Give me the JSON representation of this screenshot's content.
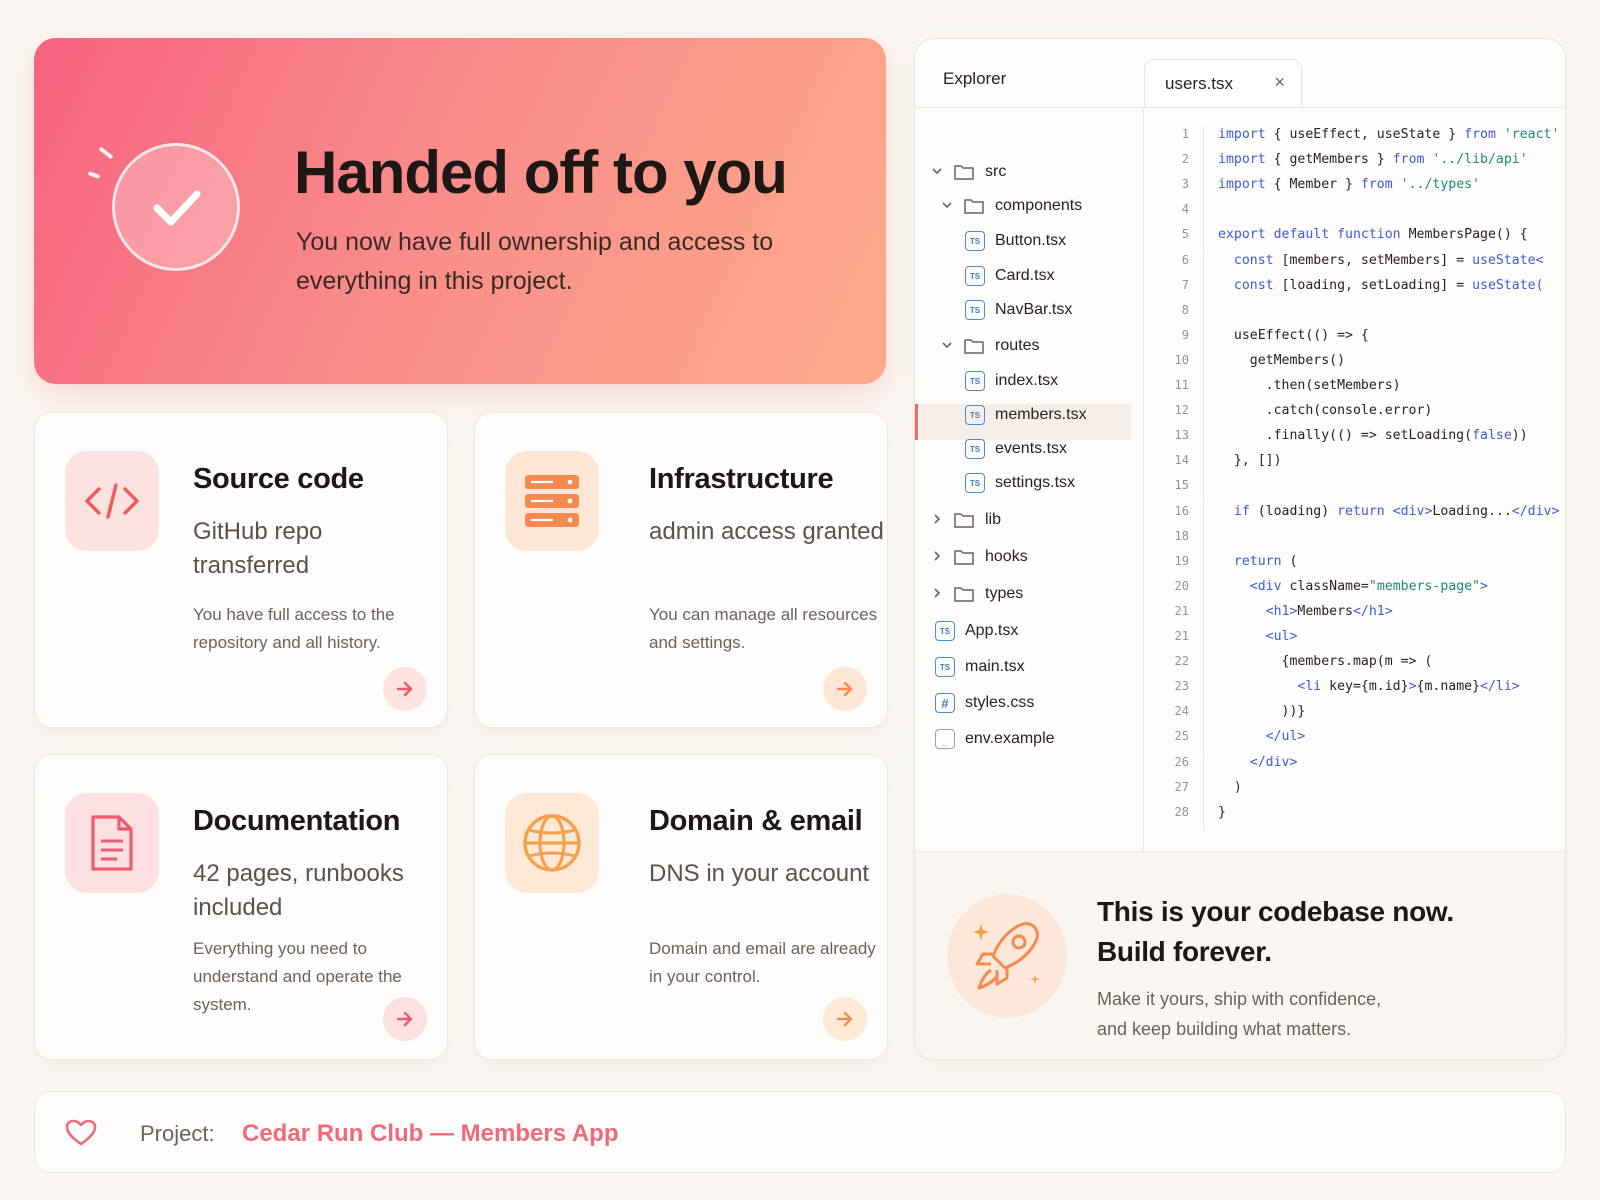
{
  "hero": {
    "title": "Handed off to you",
    "subtitle": "You now have full ownership and access to everything in this project.",
    "icon": "check-circle-icon"
  },
  "cards": [
    {
      "icon": "code-icon",
      "title": "Source code",
      "subtitle": "GitHub repo transferred",
      "description": "You have full access to the repository and all history.",
      "accent": "#f06a6a"
    },
    {
      "icon": "server-icon",
      "title": "Infrastructure",
      "subtitle": "admin access granted",
      "description": "You can manage all resources and settings.",
      "accent": "#f5894e"
    },
    {
      "icon": "document-icon",
      "title": "Documentation",
      "subtitle": "42 pages, runbooks included",
      "description": "Everything you need to understand and operate the system.",
      "accent": "#ef5a72"
    },
    {
      "icon": "globe-icon",
      "title": "Domain & email",
      "subtitle": "DNS in your account",
      "description": "Domain and email are already in your control.",
      "accent": "#f5a04a"
    }
  ],
  "editor": {
    "explorer_title": "Explorer",
    "tab": {
      "label": "users.tsx",
      "close": "×"
    },
    "tree": [
      {
        "name": "src",
        "type": "folder",
        "open": true,
        "depth": 0
      },
      {
        "name": "components",
        "type": "folder",
        "open": true,
        "depth": 1
      },
      {
        "name": "Button.tsx",
        "type": "ts",
        "depth": 2
      },
      {
        "name": "Card.tsx",
        "type": "ts",
        "depth": 2
      },
      {
        "name": "NavBar.tsx",
        "type": "ts",
        "depth": 2
      },
      {
        "name": "routes",
        "type": "folder",
        "open": true,
        "depth": 1
      },
      {
        "name": "index.tsx",
        "type": "ts",
        "depth": 2
      },
      {
        "name": "members.tsx",
        "type": "ts",
        "depth": 2,
        "active": true
      },
      {
        "name": "events.tsx",
        "type": "ts",
        "depth": 2
      },
      {
        "name": "settings.tsx",
        "type": "ts",
        "depth": 2
      },
      {
        "name": "lib",
        "type": "folder",
        "open": false,
        "depth": 0
      },
      {
        "name": "hooks",
        "type": "folder",
        "open": false,
        "depth": 0
      },
      {
        "name": "types",
        "type": "folder",
        "open": false,
        "depth": 0
      },
      {
        "name": "App.tsx",
        "type": "ts",
        "depth": 0
      },
      {
        "name": "main.tsx",
        "type": "ts",
        "depth": 0
      },
      {
        "name": "styles.css",
        "type": "css",
        "depth": 0
      },
      {
        "name": "env.example",
        "type": "env",
        "depth": 0
      }
    ],
    "ts_badge": "TS",
    "css_badge": "#",
    "env_badge": "..",
    "code_lines": [
      {
        "n": "1",
        "parts": [
          [
            "kw",
            "import"
          ],
          [
            "tx",
            " { useEffect, useState } "
          ],
          [
            "kw",
            "from"
          ],
          [
            "st",
            " 'react'"
          ]
        ]
      },
      {
        "n": "2",
        "parts": [
          [
            "kw",
            "import"
          ],
          [
            "tx",
            " { getMembers } "
          ],
          [
            "kw",
            "from"
          ],
          [
            "st",
            " '../lib/api'"
          ]
        ]
      },
      {
        "n": "3",
        "parts": [
          [
            "kw",
            "import"
          ],
          [
            "tx",
            " { Member } "
          ],
          [
            "kw",
            "from"
          ],
          [
            "st",
            " '../types'"
          ]
        ]
      },
      {
        "n": "4",
        "parts": []
      },
      {
        "n": "5",
        "parts": [
          [
            "kw",
            "export default function"
          ],
          [
            "tx",
            " MembersPage() {"
          ]
        ]
      },
      {
        "n": "6",
        "parts": [
          [
            "kw",
            "  const"
          ],
          [
            "tx",
            " [members, setMembers] = "
          ],
          [
            "kw",
            "useState<"
          ]
        ]
      },
      {
        "n": "7",
        "parts": [
          [
            "kw",
            "  const"
          ],
          [
            "tx",
            " [loading, setLoading] = "
          ],
          [
            "kw",
            "useState("
          ]
        ]
      },
      {
        "n": "8",
        "parts": []
      },
      {
        "n": "9",
        "parts": [
          [
            "tx",
            "  useEffect(() => {"
          ]
        ]
      },
      {
        "n": "10",
        "parts": [
          [
            "tx",
            "    getMembers()"
          ]
        ]
      },
      {
        "n": "11",
        "parts": [
          [
            "tx",
            "      .then(setMembers)"
          ]
        ]
      },
      {
        "n": "12",
        "parts": [
          [
            "tx",
            "      .catch(console.error)"
          ]
        ]
      },
      {
        "n": "13",
        "parts": [
          [
            "tx",
            "      .finally(() => setLoading("
          ],
          [
            "bo",
            "false"
          ],
          [
            "tx",
            "))"
          ]
        ]
      },
      {
        "n": "14",
        "parts": [
          [
            "tx",
            "  }, [])"
          ]
        ]
      },
      {
        "n": "15",
        "parts": []
      },
      {
        "n": "16",
        "parts": [
          [
            "kw",
            "  if"
          ],
          [
            "tx",
            " (loading) "
          ],
          [
            "kw",
            "return"
          ],
          [
            "tg",
            " <div>"
          ],
          [
            "tx",
            "Loading..."
          ],
          [
            "tg",
            "</div>"
          ]
        ]
      },
      {
        "n": "18",
        "parts": []
      },
      {
        "n": "19",
        "parts": [
          [
            "kw",
            "  return"
          ],
          [
            "tx",
            " ("
          ]
        ]
      },
      {
        "n": "20",
        "parts": [
          [
            "tg",
            "    <div"
          ],
          [
            "tx",
            " className="
          ],
          [
            "st",
            "\"members-page\""
          ],
          [
            "tg",
            ">"
          ]
        ]
      },
      {
        "n": "21",
        "parts": [
          [
            "tg",
            "      <h1>"
          ],
          [
            "tx",
            "Members"
          ],
          [
            "tg",
            "</h1>"
          ]
        ]
      },
      {
        "n": "21",
        "parts": [
          [
            "tg",
            "      <ul>"
          ]
        ]
      },
      {
        "n": "22",
        "parts": [
          [
            "tx",
            "        {members.map(m => ("
          ]
        ]
      },
      {
        "n": "23",
        "parts": [
          [
            "tg",
            "          <li"
          ],
          [
            "tx",
            " key={m.id}"
          ],
          [
            "tg",
            ">"
          ],
          [
            "tx",
            "{m.name}"
          ],
          [
            "tg",
            "</li>"
          ]
        ]
      },
      {
        "n": "24",
        "parts": [
          [
            "tx",
            "        ))}"
          ]
        ]
      },
      {
        "n": "25",
        "parts": [
          [
            "tg",
            "      </ul>"
          ]
        ]
      },
      {
        "n": "26",
        "parts": [
          [
            "tg",
            "    </div>"
          ]
        ]
      },
      {
        "n": "27",
        "parts": [
          [
            "tx",
            "  )"
          ]
        ]
      },
      {
        "n": "28",
        "parts": [
          [
            "tx",
            "}"
          ]
        ]
      }
    ],
    "footer": {
      "title_line1": "This is your codebase now.",
      "title_line2": "Build forever.",
      "subtitle_line1": "Make it yours, ship with confidence,",
      "subtitle_line2": "and keep building what matters.",
      "icon": "rocket-icon"
    }
  },
  "project": {
    "label": "Project:",
    "name": "Cedar Run Club — Members App",
    "icon": "heart-icon"
  },
  "colors": {
    "accent": "#f06a6a",
    "orange": "#f5894e",
    "code_keyword": "#3b5bd6",
    "code_string": "#1c8a76"
  }
}
